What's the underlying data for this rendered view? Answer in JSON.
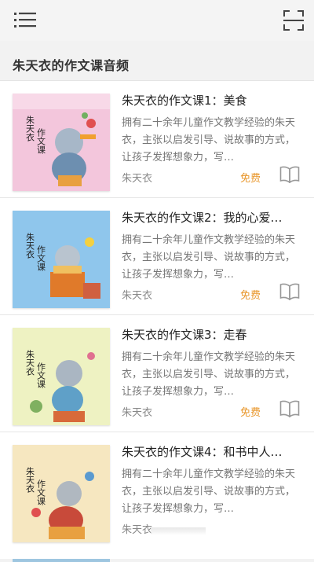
{
  "app": {
    "section_title": "朱天衣的作文课音频"
  },
  "icons": {
    "menu": "menu-icon",
    "scan": "scan-icon",
    "book": "book-open-icon"
  },
  "colors": {
    "price": "#e8962a",
    "cover_bg": [
      "#f3c6dc",
      "#8fc6ec",
      "#eef2c2",
      "#f6e7c0"
    ]
  },
  "items": [
    {
      "title": "朱天衣的作文课1：美食",
      "desc": "拥有二十余年儿童作文教学经验的朱天衣，主张以启发引导、说故事的方式，让孩子发挥想象力，写…",
      "author": "朱天衣",
      "price": "免费"
    },
    {
      "title": "朱天衣的作文课2：我的心爱…",
      "desc": "拥有二十余年儿童作文教学经验的朱天衣，主张以启发引导、说故事的方式，让孩子发挥想象力，写…",
      "author": "朱天衣",
      "price": "免费"
    },
    {
      "title": "朱天衣的作文课3：走春",
      "desc": "拥有二十余年儿童作文教学经验的朱天衣，主张以启发引导、说故事的方式，让孩子发挥想象力，写…",
      "author": "朱天衣",
      "price": "免费"
    },
    {
      "title": "朱天衣的作文课4：和书中人…",
      "desc": "拥有二十余年儿童作文教学经验的朱天衣，主张以启发引导、说故事的方式，让孩子发挥想象力，写…",
      "author": "朱天衣"
    }
  ],
  "cover_text": {
    "author": "朱天衣",
    "subtitle": "作文课"
  }
}
